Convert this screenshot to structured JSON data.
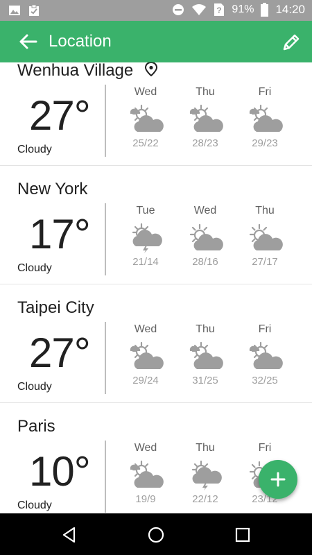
{
  "status_bar": {
    "battery": "91%",
    "time": "14:20",
    "left_icons": [
      "gallery-icon",
      "clipboard-icon"
    ],
    "right_icons": [
      "do-not-disturb-icon",
      "wifi-icon",
      "no-sim-icon",
      "battery-icon"
    ]
  },
  "app_bar": {
    "title": "Location",
    "accent_color": "#3ab26b"
  },
  "cities": [
    {
      "name": "Wenhua Village",
      "current_location": true,
      "temperature": "27°",
      "condition": "Cloudy",
      "forecast": [
        {
          "day": "Wed",
          "icon": "partly-cloudy-icon",
          "range": "25/22"
        },
        {
          "day": "Thu",
          "icon": "partly-cloudy-icon",
          "range": "28/23"
        },
        {
          "day": "Fri",
          "icon": "partly-cloudy-icon",
          "range": "29/23"
        }
      ]
    },
    {
      "name": "New York",
      "current_location": false,
      "temperature": "17°",
      "condition": "Cloudy",
      "forecast": [
        {
          "day": "Tue",
          "icon": "thunderstorm-icon",
          "range": "21/14"
        },
        {
          "day": "Wed",
          "icon": "sun-cloud-icon",
          "range": "28/16"
        },
        {
          "day": "Thu",
          "icon": "sun-cloud-icon",
          "range": "27/17"
        }
      ]
    },
    {
      "name": "Taipei City",
      "current_location": false,
      "temperature": "27°",
      "condition": "Cloudy",
      "forecast": [
        {
          "day": "Wed",
          "icon": "partly-cloudy-icon",
          "range": "29/24"
        },
        {
          "day": "Thu",
          "icon": "partly-cloudy-icon",
          "range": "31/25"
        },
        {
          "day": "Fri",
          "icon": "partly-cloudy-icon",
          "range": "32/25"
        }
      ]
    },
    {
      "name": "Paris",
      "current_location": false,
      "temperature": "10°",
      "condition": "Cloudy",
      "forecast": [
        {
          "day": "Wed",
          "icon": "partly-cloudy-icon",
          "range": "19/9"
        },
        {
          "day": "Thu",
          "icon": "thunderstorm-icon",
          "range": "22/12"
        },
        {
          "day": "Fri",
          "icon": "sun-cloud-icon",
          "range": "23/12"
        }
      ]
    }
  ],
  "nav_bar": {
    "icons": [
      "back-triangle-icon",
      "home-circle-icon",
      "recents-square-icon"
    ]
  }
}
